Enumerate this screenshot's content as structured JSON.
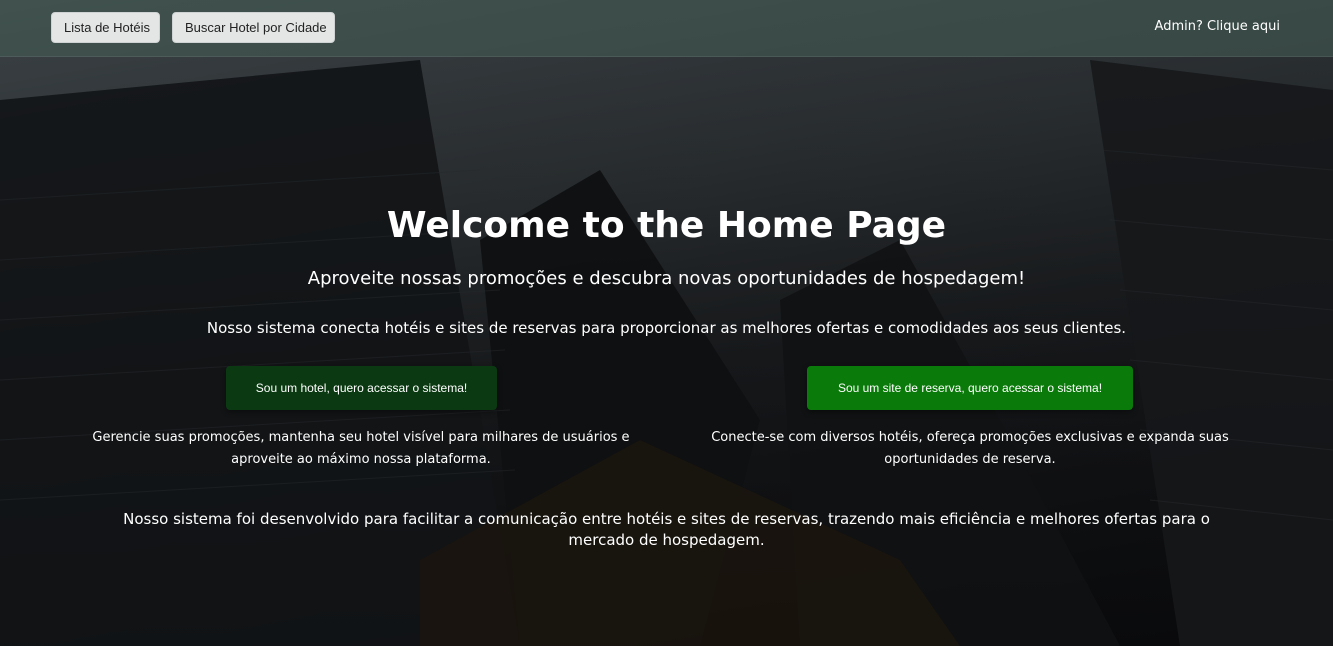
{
  "navbar": {
    "hotels_list_label": "Lista de Hotéis",
    "search_by_city_label": "Buscar Hotel por Cidade",
    "admin_link_label": "Admin? Clique aqui"
  },
  "hero": {
    "title": "Welcome to the Home Page",
    "subtitle": "Aproveite nossas promoções e descubra novas oportunidades de hospedagem!",
    "description": "Nosso sistema conecta hotéis e sites de reservas para proporcionar as melhores ofertas e comodidades aos seus clientes."
  },
  "columns": {
    "hotel": {
      "button_label": "Sou um hotel, quero acessar o sistema!",
      "text": "Gerencie suas promoções, mantenha seu hotel visível para milhares de usuários e aproveite ao máximo nossa plataforma."
    },
    "booking_site": {
      "button_label": "Sou um site de reserva, quero acessar o sistema!",
      "text": "Conecte-se com diversos hotéis, ofereça promoções exclusivas e expanda suas oportunidades de reserva."
    }
  },
  "footer": {
    "text": "Nosso sistema foi desenvolvido para facilitar a comunicação entre hotéis e sites de reservas, trazendo mais eficiência e melhores ofertas para o mercado de hospedagem."
  },
  "colors": {
    "hotel_button": "#0b3a12",
    "site_button": "#0a7a0a",
    "navbar": "#465f55"
  }
}
